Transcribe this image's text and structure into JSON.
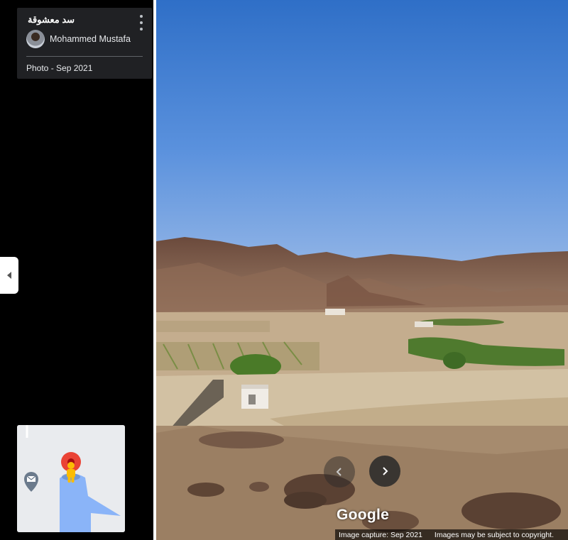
{
  "info_card": {
    "place_name": "سد معشوقة",
    "author": "Mohammed Mustafa",
    "photo_date": "Photo - Sep 2021"
  },
  "icons": {
    "more": "more-vert-icon",
    "collapse": "chevron-left-icon",
    "nav_back": "chevron-left-icon",
    "nav_forward": "chevron-right-icon",
    "pegman": "pegman-icon",
    "mail": "mail-icon"
  },
  "imagery": {
    "logo": "Google",
    "capture": "Image capture: Sep 2021",
    "copyright": "Images may be subject to copyright."
  },
  "colors": {
    "panel": "#000000",
    "card": "#202124",
    "map_bg": "#e9ebee",
    "view_cone": "#8ab4f8",
    "pin": "#ea4335",
    "pegman": "#fbbc04"
  }
}
